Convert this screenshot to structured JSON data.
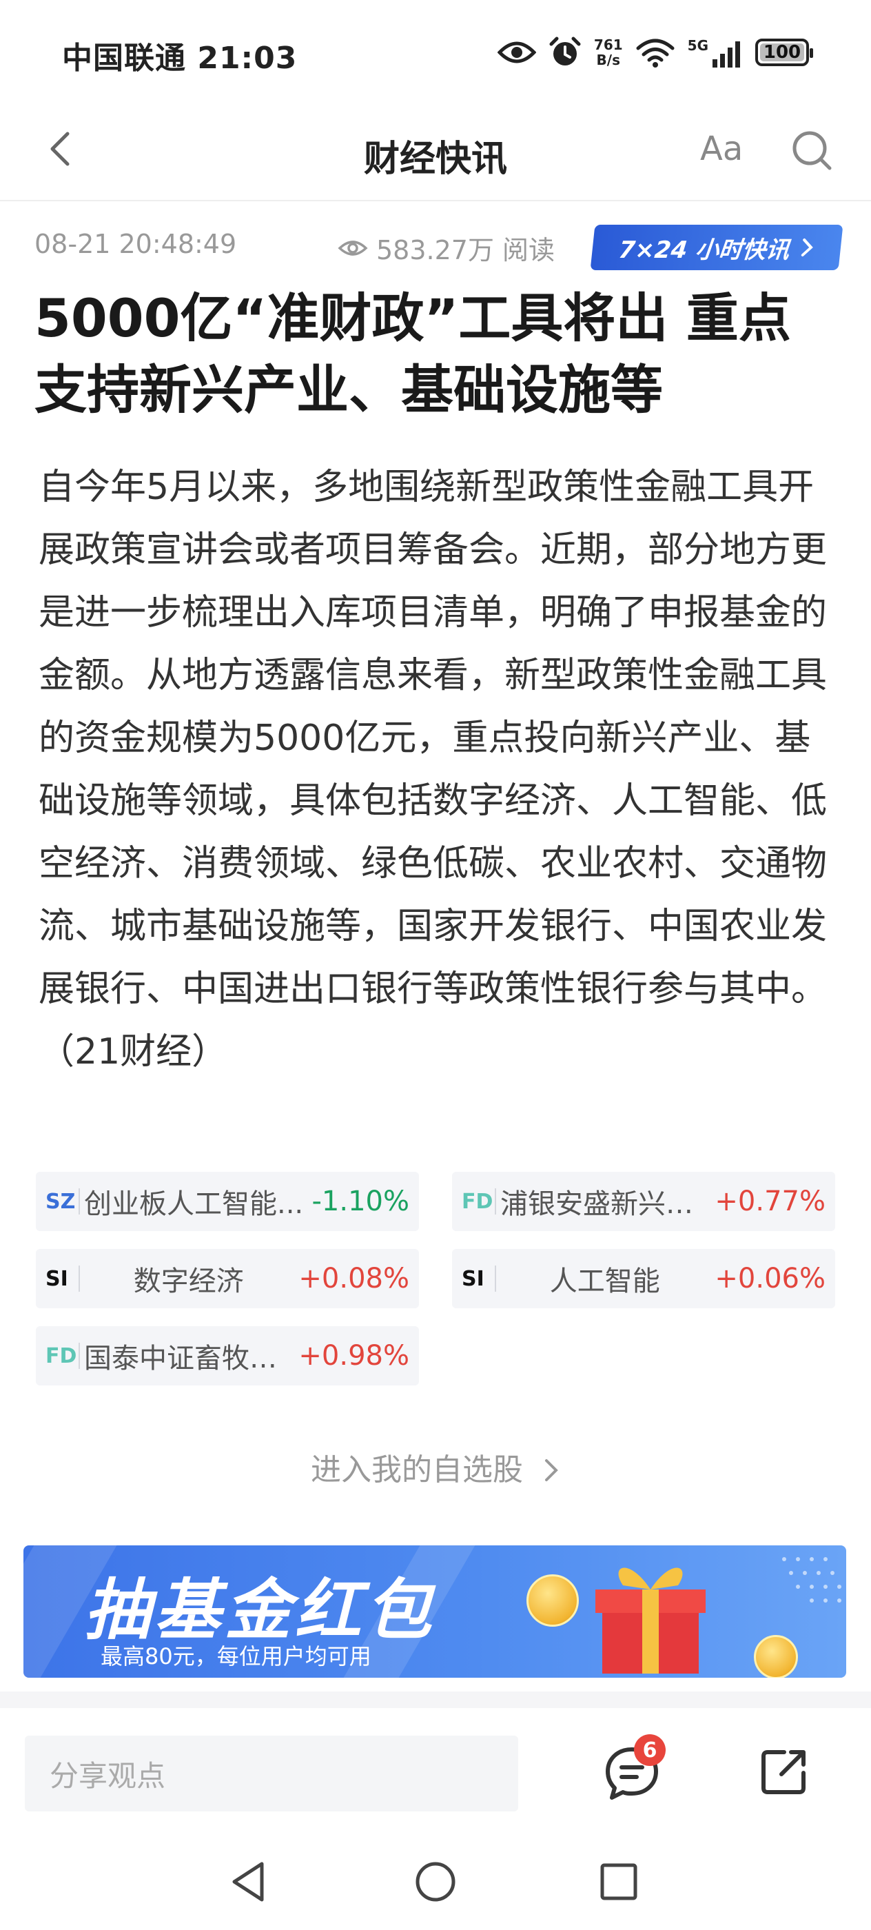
{
  "status_bar": {
    "carrier": "中国联通",
    "time": "21:03",
    "net_speed_value": "761",
    "net_speed_unit": "B/s",
    "network": "5G",
    "battery": "100"
  },
  "nav": {
    "title": "财经快讯",
    "font_size_label": "Aa"
  },
  "meta": {
    "publish_time": "08-21 20:48:49",
    "read_count": "583.27万 阅读",
    "feed_badge": "7×24 小时快讯"
  },
  "article": {
    "headline": "5000亿“准财政”工具将出 重点支持新兴产业、基础设施等",
    "body": "自今年5月以来，多地围绕新型政策性金融工具开展政策宣讲会或者项目筹备会。近期，部分地方更是进一步梳理出入库项目清单，明确了申报基金的金额。从地方透露信息来看，新型政策性金融工具的资金规模为5000亿元，重点投向新兴产业、基础设施等领域，具体包括数字经济、人工智能、低空经济、消费领域、绿色低碳、农业农村、交通物流、城市基础设施等，国家开发银行、中国农业发展银行、中国进出口银行等政策性银行参与其中。（21财经）"
  },
  "related": [
    {
      "tag": "SZ",
      "name": "创业板人工智能...",
      "change": "-1.10%",
      "direction": "down"
    },
    {
      "tag": "FD",
      "name": "浦银安盛新兴产...",
      "change": "+0.77%",
      "direction": "up"
    },
    {
      "tag": "SI",
      "name": "数字经济",
      "change": "+0.08%",
      "direction": "up"
    },
    {
      "tag": "SI",
      "name": "人工智能",
      "change": "+0.06%",
      "direction": "up"
    },
    {
      "tag": "FD",
      "name": "国泰中证畜牧养...",
      "change": "+0.98%",
      "direction": "up"
    }
  ],
  "watchlist_link": "进入我的自选股",
  "banner": {
    "title": "抽基金红包",
    "subtitle": "最高80元，每位用户均可用"
  },
  "bottom_bar": {
    "comment_placeholder": "分享观点",
    "comment_count": "6"
  },
  "colors": {
    "accent_blue": "#2a5ad6",
    "down_green": "#1aa260",
    "up_red": "#e2453c",
    "badge_red": "#e8453c"
  }
}
